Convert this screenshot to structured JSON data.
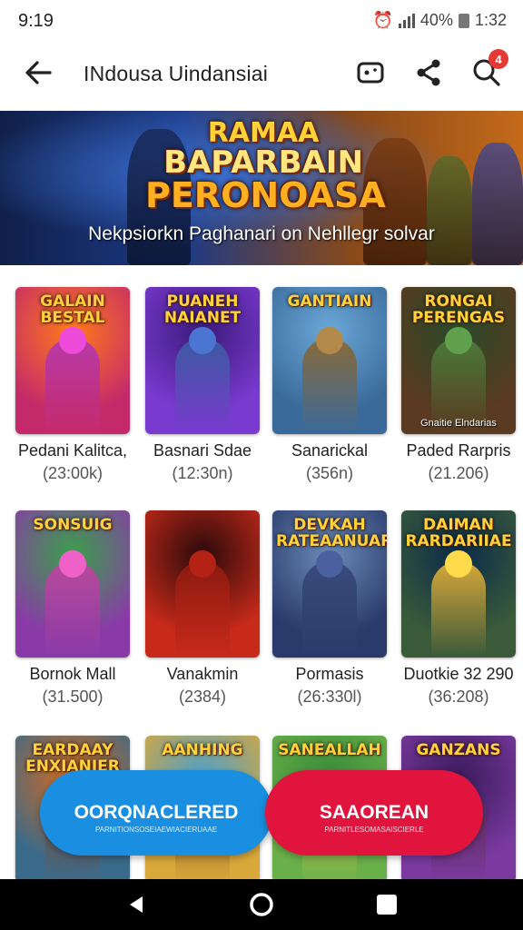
{
  "status_bar": {
    "time": "9:19",
    "battery": "40%",
    "clock": "1:32"
  },
  "app_bar": {
    "title": "INdousa Uindansiai",
    "notification_count": "4"
  },
  "banner": {
    "title_lines": [
      "RAMAA",
      "BAPARBAIN",
      "PERONOASA"
    ],
    "subtitle": "Nekpsiorkn Paghanari on Nehllegr solvar"
  },
  "games": [
    {
      "thumb_title": "GALAIN\nBESTAL",
      "name": "Pedani Kalitca,",
      "count": "(23:00k)",
      "caption": "",
      "colors": [
        "#ff7a1a",
        "#c42a6a",
        "#b83aa8"
      ]
    },
    {
      "thumb_title": "PUANEH\nNAIANET",
      "name": "Basnari Sdae",
      "count": "(12:30n)",
      "caption": "",
      "colors": [
        "#3a1a7a",
        "#7a3ad0",
        "#3a5aa0"
      ]
    },
    {
      "thumb_title": "GANTIAIN",
      "name": "Sanarickal",
      "count": "(356n)",
      "caption": "",
      "colors": [
        "#6aa8d8",
        "#3a6a9a",
        "#8a6a3a"
      ]
    },
    {
      "thumb_title": "RONGAI\nPERENGAS",
      "name": "Paded Rarpris",
      "count": "(21.206)",
      "caption": "Gnaitie Elndarias",
      "colors": [
        "#2a4a2a",
        "#5a3a20",
        "#4a7a3a"
      ]
    },
    {
      "thumb_title": "SONSUIG",
      "name": "Bornok Mall",
      "count": "(31.500)",
      "caption": "",
      "colors": [
        "#3aa04a",
        "#8a3aa8",
        "#b84a9a"
      ]
    },
    {
      "thumb_title": "",
      "name": "Vanakmin",
      "count": "(2384)",
      "caption": "",
      "colors": [
        "#2a0a0a",
        "#c82a1a",
        "#8a1a10"
      ]
    },
    {
      "thumb_title": "DEVKAH\nRATEAANUAR",
      "name": "Pormasis",
      "count": "(26:330l)",
      "caption": "",
      "colors": [
        "#6a8ab8",
        "#2a3a6a",
        "#3a4a7a"
      ]
    },
    {
      "thumb_title": "DAIMAN\nRARDARIIAE",
      "name": "Duotkie 32 290",
      "count": "(36:208)",
      "caption": "",
      "colors": [
        "#0a2a4a",
        "#3a5a3a",
        "#d8a83a"
      ]
    },
    {
      "thumb_title": "EARDAAY\nENXIANIER",
      "name": "",
      "count": "",
      "caption": "",
      "colors": [
        "#d86a1a",
        "#3a6a8a",
        "#8a4a2a"
      ]
    },
    {
      "thumb_title": "AANHING",
      "name": "",
      "count": "",
      "caption": "",
      "colors": [
        "#4aa0d0",
        "#d8a83a",
        "#8a5a2a"
      ]
    },
    {
      "thumb_title": "SANEALLAH",
      "name": "",
      "count": "",
      "caption": "",
      "colors": [
        "#3a8a3a",
        "#6ab04a",
        "#d8c84a"
      ]
    },
    {
      "thumb_title": "GANZANS",
      "name": "",
      "count": "",
      "caption": "",
      "colors": [
        "#3a1a5a",
        "#7a3aa0",
        "#5a2a4a"
      ]
    }
  ],
  "buttons": {
    "left_label": "OORQNACLERED",
    "left_sub": "PARNITIONSOSEIAEWIACIERUAAE",
    "right_label": "SAAOREAN",
    "right_sub": "PARNITLESOMASAISCIERLE"
  },
  "colors": {
    "left_button": "#1a8ee0",
    "right_button": "#e0143c",
    "badge": "#e53935"
  }
}
